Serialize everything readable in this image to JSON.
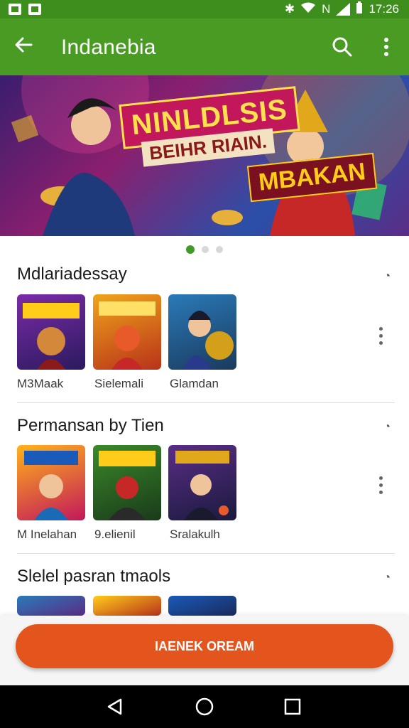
{
  "status_bar": {
    "time": "17:26",
    "network": "N"
  },
  "app_bar": {
    "title": "Indanebia"
  },
  "banner": {
    "line1": "NINLDLSIS",
    "line2": "BEIHR RIAIN.",
    "line3": "MBAKAN"
  },
  "carousel": {
    "count": 3,
    "active": 0
  },
  "sections": [
    {
      "title": "Mdlariadessay",
      "items": [
        "M3Maak",
        "Sielemali",
        "Glamdan"
      ]
    },
    {
      "title": "Permansan by Tien",
      "items": [
        "M Inelahan",
        "9.elienil",
        "Sralakulh"
      ]
    },
    {
      "title": "Slelel pasran tmaols",
      "items": []
    }
  ],
  "cta": {
    "label": "IAENEK OREAM"
  },
  "colors": {
    "primary": "#4a9b23",
    "status": "#3e8e1e",
    "accent": "#e4541d"
  }
}
